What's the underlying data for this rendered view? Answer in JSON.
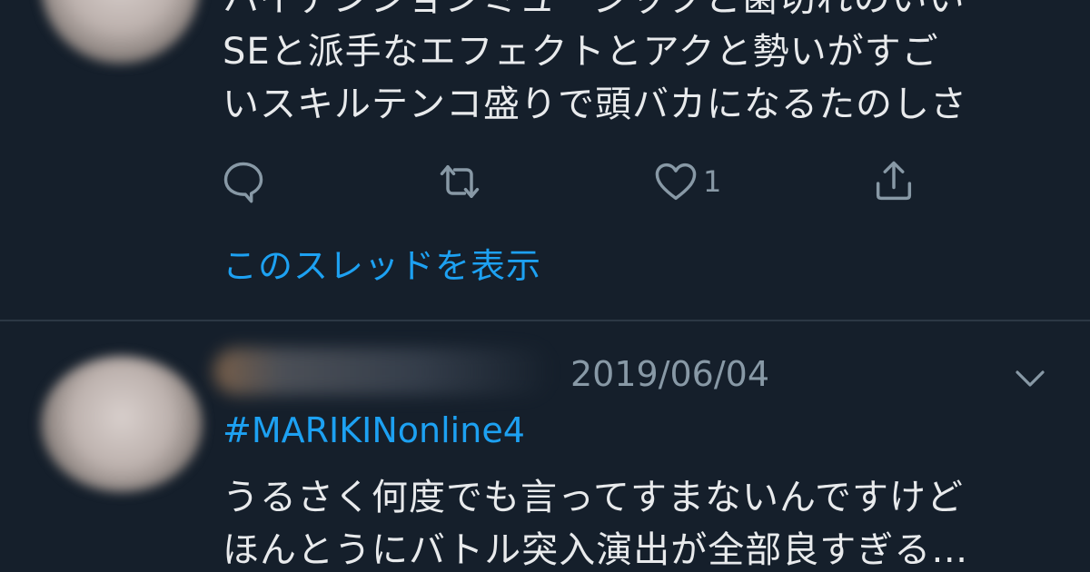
{
  "tweet1": {
    "lines": [
      "ハイテンションミュージックと歯切れのいい",
      "SEと派手なエフェクトとアクと勢いがすご",
      "いスキルテンコ盛りで頭バカになるたのしさ"
    ],
    "actions": {
      "reply_icon": "reply-icon",
      "retweet_icon": "retweet-icon",
      "like_icon": "heart-icon",
      "like_count": "1",
      "share_icon": "share-icon"
    },
    "thread_link": "このスレッドを表示"
  },
  "tweet2": {
    "date": "2019/06/04",
    "hashtag": "#MARIKINonline4",
    "lines": [
      "うるさく何度でも言ってすまないんですけど",
      "ほんとうにバトル突入演出が全部良すぎる…"
    ],
    "menu_icon": "chevron-down-icon"
  },
  "colors": {
    "background": "#151f2b",
    "text": "#e8eaec",
    "secondary": "#8899a6",
    "link": "#1da1f2",
    "divider": "#2c3845"
  }
}
